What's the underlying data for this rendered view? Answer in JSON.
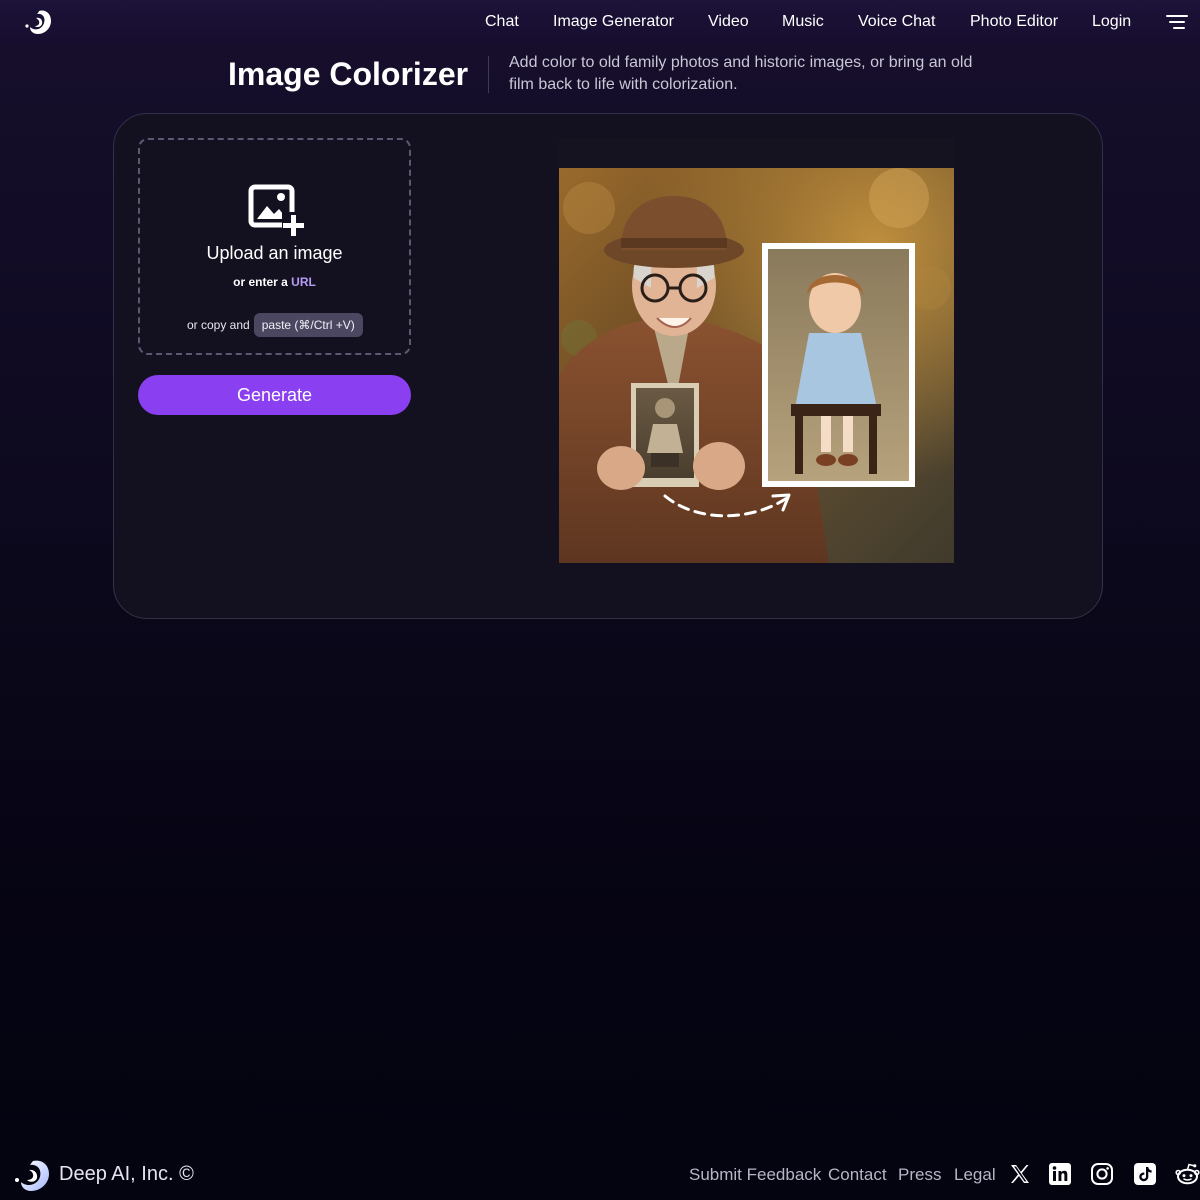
{
  "header": {
    "logo": "deepai-swirl-icon",
    "nav": [
      {
        "label": "Chat"
      },
      {
        "label": "Image Generator"
      },
      {
        "label": "Video"
      },
      {
        "label": "Music"
      },
      {
        "label": "Voice Chat"
      },
      {
        "label": "Photo Editor"
      },
      {
        "label": "Login"
      }
    ],
    "menu_icon": "hamburger-menu-icon"
  },
  "page": {
    "title": "Image Colorizer",
    "subtitle": "Add color to old family photos and historic images, or bring an old film back to life with colorization."
  },
  "uploader": {
    "icon": "image-add-icon",
    "title": "Upload an image",
    "url_prefix": "or enter a",
    "url_link": "URL",
    "paste_prefix": "or copy and",
    "paste_button": "paste (⌘/Ctrl +V)"
  },
  "actions": {
    "generate_label": "Generate"
  },
  "footer": {
    "brand": "Deep AI, Inc. ©",
    "links": [
      {
        "label": "Submit Feedback"
      },
      {
        "label": "Contact"
      },
      {
        "label": "Press"
      },
      {
        "label": "Legal"
      }
    ],
    "social": [
      "x-icon",
      "linkedin-icon",
      "instagram-icon",
      "tiktok-icon",
      "reddit-icon"
    ]
  },
  "colors": {
    "accent": "#8a3ff0",
    "link": "#b69cf4",
    "panel": "#13111f"
  }
}
